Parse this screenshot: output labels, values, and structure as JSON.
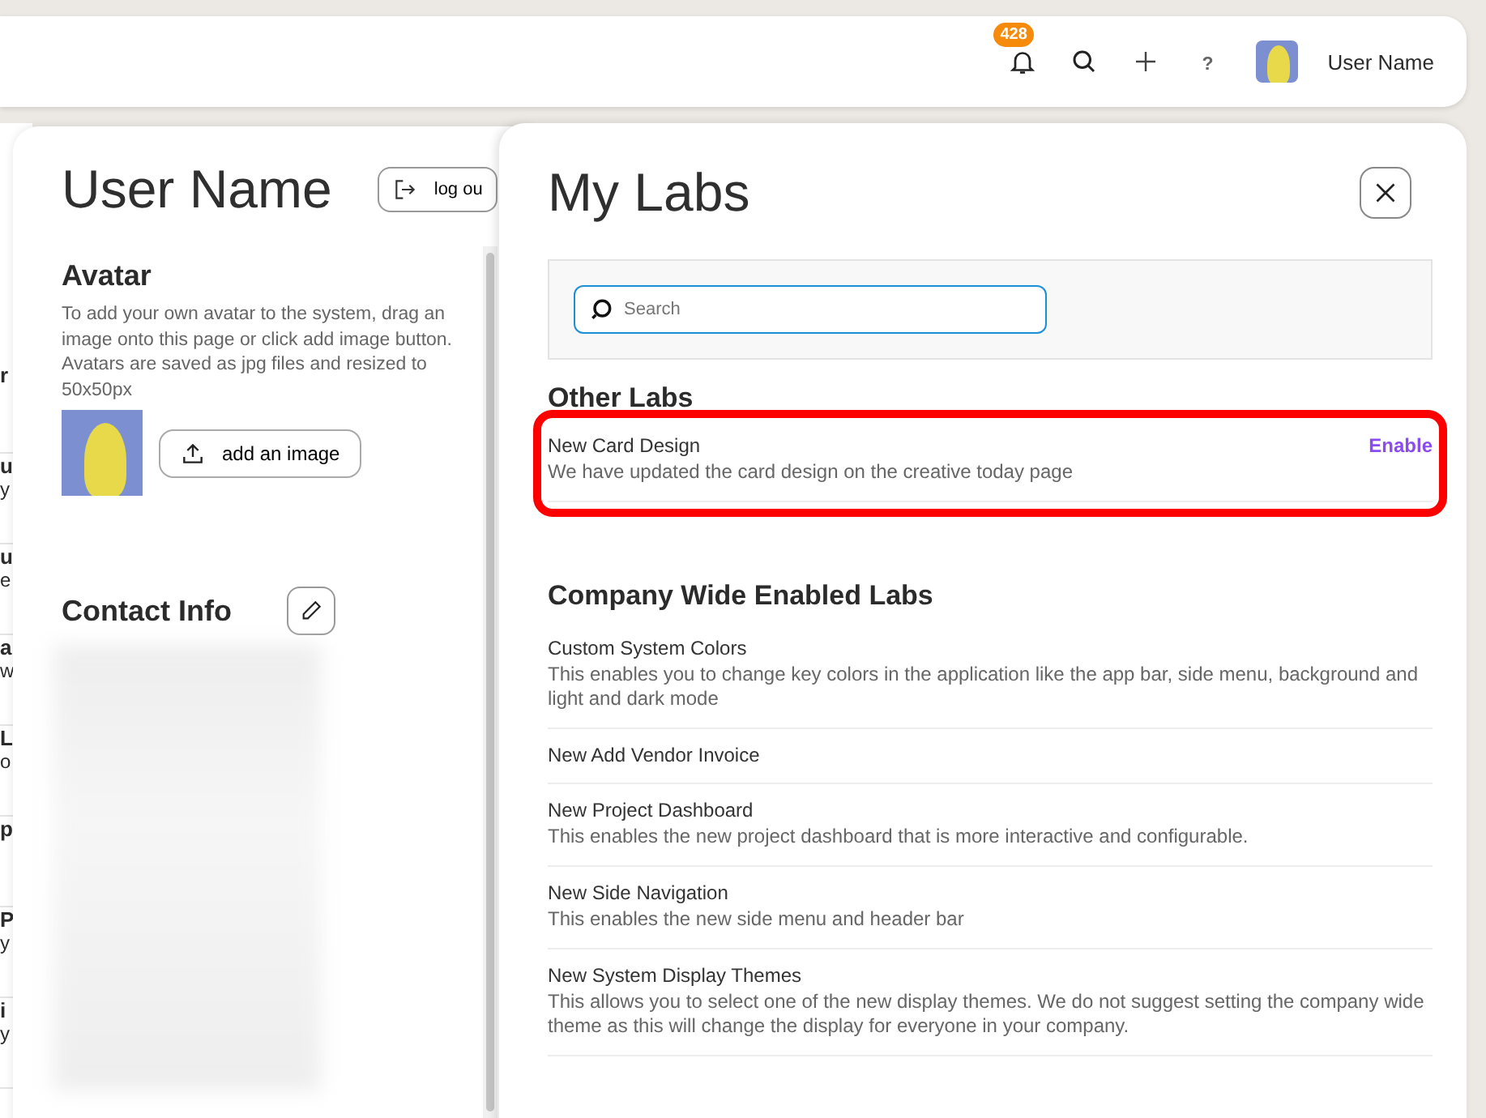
{
  "top_bar": {
    "notification_count": "428",
    "help_label": "?",
    "user_name": "User Name"
  },
  "background_fragments": [
    {
      "title": "r"
    },
    {
      "title": "u",
      "text": "y"
    },
    {
      "title": "u",
      "text": "e"
    },
    {
      "title": "a",
      "text": "w"
    },
    {
      "title": "L",
      "text": "o"
    },
    {
      "title": "p"
    },
    {
      "title": "P",
      "text": "y"
    },
    {
      "title": "i",
      "text": "y"
    }
  ],
  "profile": {
    "title": "User Name",
    "logout_label": "log ou",
    "avatar_heading": "Avatar",
    "avatar_help": "To add your own avatar to the system, drag an image onto this page or click add image button. Avatars are saved as jpg files and resized to 50x50px",
    "add_image_label": "add an image",
    "contact_heading": "Contact Info"
  },
  "labs_dialog": {
    "title": "My Labs",
    "search": {
      "placeholder": "Search"
    },
    "sections": [
      {
        "heading": "Other Labs",
        "items": [
          {
            "name": "New Card Design",
            "description": "We have updated the card design on the creative today page",
            "action": "Enable",
            "highlighted": true
          }
        ]
      },
      {
        "heading": "Company Wide Enabled Labs",
        "items": [
          {
            "name": "Custom System Colors",
            "description": "This enables you to change key colors in the application like the app bar, side menu, background and light and dark mode",
            "highlighted": false
          },
          {
            "name": "New Add Vendor Invoice",
            "highlighted": false
          },
          {
            "name": "New Project Dashboard",
            "description": "This enables the new project dashboard that is more interactive and configurable.",
            "highlighted": false
          },
          {
            "name": "New Side Navigation",
            "description": "This enables the new side menu and header bar",
            "highlighted": false
          },
          {
            "name": "New System Display Themes",
            "description": "This allows you to select one of the new display themes. We do not suggest setting the company wide theme as this will change the display for everyone in your company.",
            "highlighted": false
          }
        ]
      }
    ]
  }
}
